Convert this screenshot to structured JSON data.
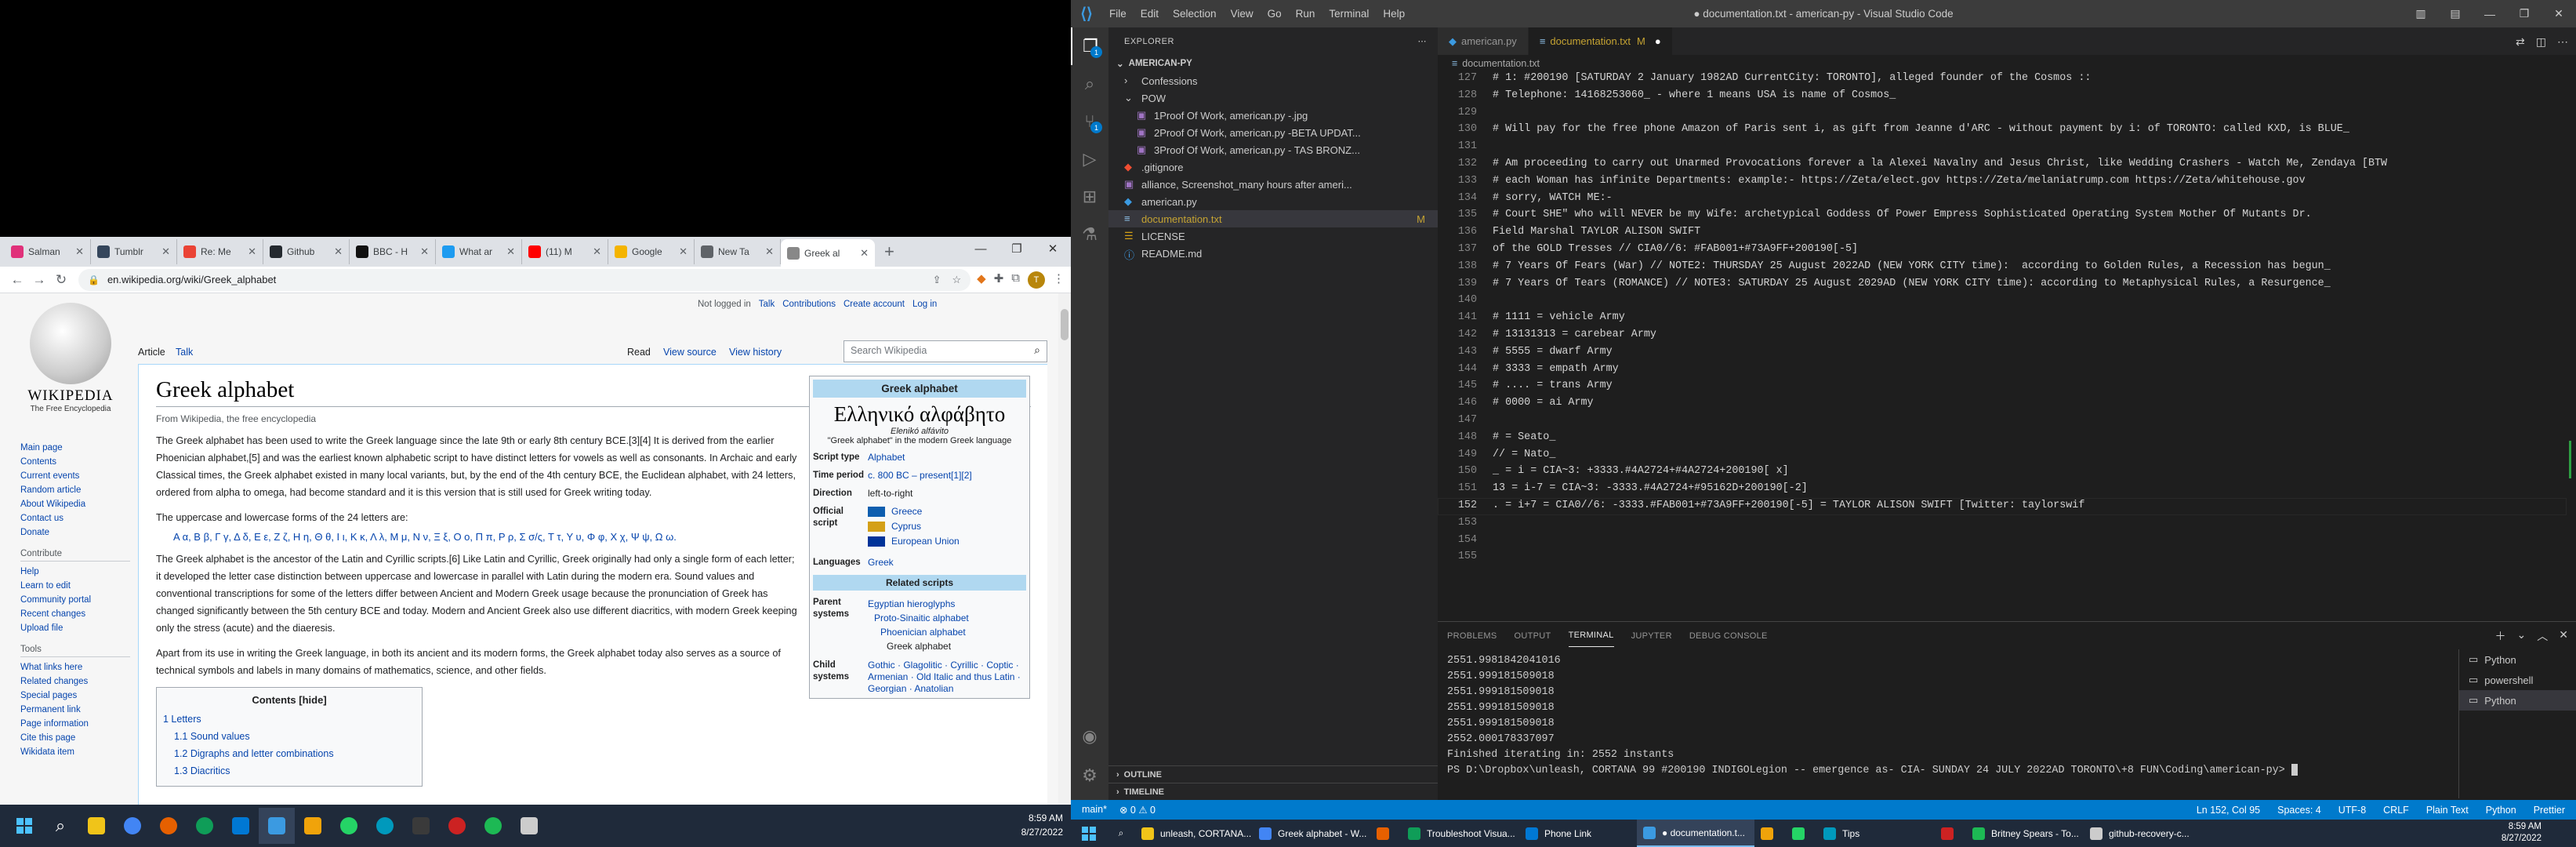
{
  "chrome": {
    "tabs": [
      {
        "label": "Salman",
        "color": "#e0317a"
      },
      {
        "label": "Tumblr",
        "color": "#35465c"
      },
      {
        "label": "Re: Me",
        "color": "#ea4335"
      },
      {
        "label": "Github",
        "color": "#24292f"
      },
      {
        "label": "BBC - H",
        "color": "#111111"
      },
      {
        "label": "What ar",
        "color": "#1d9bf0"
      },
      {
        "label": "(11) M",
        "color": "#ff0000"
      },
      {
        "label": "Google",
        "color": "#f4b400"
      },
      {
        "label": "New Ta",
        "color": "#5f6368"
      },
      {
        "label": "Greek al",
        "color": "#888888"
      }
    ],
    "url": "en.wikipedia.org/wiki/Greek_alphabet"
  },
  "wiki": {
    "logo_text": "WIKIPEDIA",
    "logo_sub": "The Free Encyclopedia",
    "top_links": [
      "Not logged in",
      "Talk",
      "Contributions",
      "Create account",
      "Log in"
    ],
    "tabs": {
      "article": "Article",
      "talk": "Talk",
      "read": "Read",
      "view_source": "View source",
      "history": "View history"
    },
    "search_placeholder": "Search Wikipedia",
    "nav": [
      "Main page",
      "Contents",
      "Current events",
      "Random article",
      "About Wikipedia",
      "Contact us",
      "Donate"
    ],
    "contribute_title": "Contribute",
    "contribute": [
      "Help",
      "Learn to edit",
      "Community portal",
      "Recent changes",
      "Upload file"
    ],
    "tools_title": "Tools",
    "tools": [
      "What links here",
      "Related changes",
      "Special pages",
      "Permanent link",
      "Page information",
      "Cite this page",
      "Wikidata item"
    ],
    "title": "Greek alphabet",
    "from": "From Wikipedia, the free encyclopedia",
    "p1": "The Greek alphabet has been used to write the Greek language since the late 9th or early 8th century BCE.[3][4] It is derived from the earlier Phoenician alphabet,[5] and was the earliest known alphabetic script to have distinct letters for vowels as well as consonants. In Archaic and early Classical times, the Greek alphabet existed in many local variants, but, by the end of the 4th century BCE, the Euclidean alphabet, with 24 letters, ordered from alpha to omega, had become standard and it is this version that is still used for Greek writing today.",
    "p2": "The uppercase and lowercase forms of the 24 letters are:",
    "letters": "Α α,  Β β,  Γ γ,  Δ δ,  Ε ε,  Ζ ζ,  Η η,  Θ θ,  Ι ι,  Κ κ,  Λ λ,  Μ μ,  Ν ν,  Ξ ξ,  Ο ο,  Π π,  Ρ ρ,  Σ σ/ς,  Τ τ,  Υ υ,  Φ φ,  Χ χ,  Ψ ψ,  Ω ω.",
    "p3": "The Greek alphabet is the ancestor of the Latin and Cyrillic scripts.[6] Like Latin and Cyrillic, Greek originally had only a single form of each letter; it developed the letter case distinction between uppercase and lowercase in parallel with Latin during the modern era. Sound values and conventional transcriptions for some of the letters differ between Ancient and Modern Greek usage because the pronunciation of Greek has changed significantly between the 5th century BCE and today. Modern and Ancient Greek also use different diacritics, with modern Greek keeping only the stress (acute) and the diaeresis.",
    "p4": "Apart from its use in writing the Greek language, in both its ancient and its modern forms, the Greek alphabet today also serves as a source of technical symbols and labels in many domains of mathematics, science, and other fields.",
    "toc_title": "Contents [hide]",
    "toc": [
      "1  Letters",
      "1.1  Sound values",
      "1.2  Digraphs and letter combinations",
      "1.3  Diacritics"
    ],
    "infobox": {
      "head": "Greek alphabet",
      "greek": "Ελληνικό αλφάβητο",
      "italic": "Elenikó alfávito",
      "caption": "\"Greek alphabet\" in the modern Greek language",
      "rows": [
        {
          "k": "Script type",
          "v": "Alphabet"
        },
        {
          "k": "Time period",
          "v": "c. 800 BC – present[1][2]"
        },
        {
          "k": "Direction",
          "v": "left-to-right"
        }
      ],
      "official_k": "Official script",
      "official": [
        "Greece",
        "Cyprus",
        "European Union"
      ],
      "lang_k": "Languages",
      "lang_v": "Greek",
      "related": "Related scripts",
      "parent_k": "Parent systems",
      "parent": [
        "Egyptian hieroglyphs",
        "Proto-Sinaitic alphabet",
        "Phoenician alphabet",
        "Greek alphabet"
      ],
      "child_k": "Child systems",
      "child": "Gothic · Glagolitic · Cyrillic · Coptic · Armenian · Old Italic and thus Latin · Georgian · Anatolian"
    }
  },
  "ltask": {
    "time": "8:59 AM",
    "date": "8/27/2022"
  },
  "vscode": {
    "menu": [
      "File",
      "Edit",
      "Selection",
      "View",
      "Go",
      "Run",
      "Terminal",
      "Help"
    ],
    "title": "● documentation.txt - american-py - Visual Studio Code",
    "explorer": "EXPLORER",
    "project": "AMERICAN-PY",
    "files": [
      {
        "name": "Confessions",
        "type": "folder",
        "indent": 1,
        "open": false
      },
      {
        "name": "POW",
        "type": "folder",
        "indent": 1,
        "open": true
      },
      {
        "name": "1Proof Of Work, american.py -.jpg",
        "type": "image",
        "indent": 2
      },
      {
        "name": "2Proof Of Work, american.py -BETA UPDAT...",
        "type": "image",
        "indent": 2
      },
      {
        "name": "3Proof Of Work, american.py - TAS BRONZ...",
        "type": "image",
        "indent": 2
      },
      {
        "name": ".gitignore",
        "type": "git",
        "indent": 1
      },
      {
        "name": "alliance, Screenshot_many hours after ameri...",
        "type": "image",
        "indent": 1
      },
      {
        "name": "american.py",
        "type": "py",
        "indent": 1
      },
      {
        "name": "documentation.txt",
        "type": "txt",
        "indent": 1,
        "mod": "M",
        "sel": true
      },
      {
        "name": "LICENSE",
        "type": "lic",
        "indent": 1
      },
      {
        "name": "README.md",
        "type": "md",
        "indent": 1
      }
    ],
    "outline": "OUTLINE",
    "timeline": "TIMELINE",
    "tabs": [
      {
        "label": "american.py",
        "on": false,
        "kind": "py"
      },
      {
        "label": "documentation.txt",
        "mod": "M",
        "on": true,
        "kind": "txt"
      }
    ],
    "breadcrumb": "documentation.txt",
    "lines": [
      {
        "n": "127",
        "t": "# 1: #200190 [SATURDAY 2 January 1982AD CurrentCity: TORONTO], alleged founder of the Cosmos ::"
      },
      {
        "n": "128",
        "t": "# Telephone: 14168253060_ - where 1 means USA is name of Cosmos_"
      },
      {
        "n": "129",
        "t": ""
      },
      {
        "n": "130",
        "t": "# Will pay for the free phone Amazon of Paris sent i, as gift from Jeanne d'ARC - without payment by i: of TORONTO: called KXD, is BLUE_"
      },
      {
        "n": "131",
        "t": ""
      },
      {
        "n": "132",
        "t": "# Am proceeding to carry out Unarmed Provocations forever a la Alexei Navalny and Jesus Christ, like Wedding Crashers - Watch Me, Zendaya [BTW"
      },
      {
        "n": "133",
        "t": "# each Woman has infinite Departments: example:- https://Zeta/elect.gov https://Zeta/melaniatrump.com https://Zeta/whitehouse.gov"
      },
      {
        "n": "134",
        "t": "# sorry, WATCH ME:-"
      },
      {
        "n": "135",
        "t": "# Court SHE\" who will NEVER be my Wife: archetypical Goddess Of Power Empress Sophisticated Operating System Mother Of Mutants Dr."
      },
      {
        "n": "136",
        "t": "Field Marshal TAYLOR ALISON SWIFT"
      },
      {
        "n": "137",
        "t": "of the GOLD Tresses // CIA0//6: #FAB001+#73A9FF+200190[-5]"
      },
      {
        "n": "138",
        "t": "# 7 Years Of Fears (War) // NOTE2: THURSDAY 25 August 2022AD (NEW YORK CITY time):  according to Golden Rules, a Recession has begun_"
      },
      {
        "n": "139",
        "t": "# 7 Years Of Tears (ROMANCE) // NOTE3: SATURDAY 25 August 2029AD (NEW YORK CITY time): according to Metaphysical Rules, a Resurgence_"
      },
      {
        "n": "140",
        "t": ""
      },
      {
        "n": "141",
        "t": "# 1111 = vehicle Army"
      },
      {
        "n": "142",
        "t": "# 13131313 = carebear Army"
      },
      {
        "n": "143",
        "t": "# 5555 = dwarf Army"
      },
      {
        "n": "144",
        "t": "# 3333 = empath Army"
      },
      {
        "n": "145",
        "t": "# .... = trans Army"
      },
      {
        "n": "146",
        "t": "# 0000 = ai Army"
      },
      {
        "n": "147",
        "t": ""
      },
      {
        "n": "148",
        "t": "# = Seato_"
      },
      {
        "n": "149",
        "t": "// = Nato_"
      },
      {
        "n": "150",
        "t": "_ = i = CIA~3: +3333.#4A2724+#4A2724+200190[ x]"
      },
      {
        "n": "151",
        "t": "13 = i-7 = CIA~3: -3333.#4A2724+#95162D+200190[-2]"
      },
      {
        "n": "152",
        "t": ". = i+7 = CIA0//6: -3333.#FAB001+#73A9FF+200190[-5] = TAYLOR ALISON SWIFT [Twitter: taylorswif"
      },
      {
        "n": "153",
        "t": ""
      },
      {
        "n": "154",
        "t": ""
      },
      {
        "n": "155",
        "t": ""
      }
    ],
    "panel_tabs": [
      "PROBLEMS",
      "OUTPUT",
      "TERMINAL",
      "JUPYTER",
      "DEBUG CONSOLE"
    ],
    "terminal": [
      "2551.9981842041016",
      "2551.999181509018",
      "2551.999181509018",
      "2551.999181509018",
      "2551.999181509018",
      "2552.000178337097",
      "Finished iterating in: 2552 instants",
      "PS D:\\Dropbox\\unleash, CORTANA 99 #200190 INDIGOLegion -- emergence as- CIA- SUNDAY 24 JULY 2022AD TORONTO\\+8 FUN\\Coding\\american-py> "
    ],
    "terminals": [
      "Python",
      "powershell",
      "Python"
    ],
    "status_left": [
      "main*",
      "⊗ 0 ⚠ 0"
    ],
    "status_right": [
      "Ln 152, Col 95",
      "Spaces: 4",
      "UTF-8",
      "CRLF",
      "Plain Text",
      "Python",
      "Prettier"
    ]
  },
  "rtask": {
    "buttons": [
      {
        "label": "unleash, CORTANA...",
        "color": "#f0c419"
      },
      {
        "label": "Greek alphabet - W...",
        "color": "#4285f4"
      },
      {
        "label": "",
        "color": "#e66000"
      },
      {
        "label": "Troubleshoot Visua...",
        "color": "#0f9d58"
      },
      {
        "label": "Phone Link",
        "color": "#0078d4"
      },
      {
        "label": "● documentation.t...",
        "color": "#3b9ae1",
        "on": true
      },
      {
        "label": "",
        "color": "#f0a30a"
      },
      {
        "label": "",
        "color": "#25d366"
      },
      {
        "label": "Tips",
        "color": "#0099bc"
      },
      {
        "label": "",
        "color": "#cc2222"
      },
      {
        "label": "Britney Spears - To...",
        "color": "#1db954"
      },
      {
        "label": "github-recovery-c...",
        "color": "#cccccc"
      }
    ],
    "time": "8:59 AM",
    "date": "8/27/2022"
  }
}
